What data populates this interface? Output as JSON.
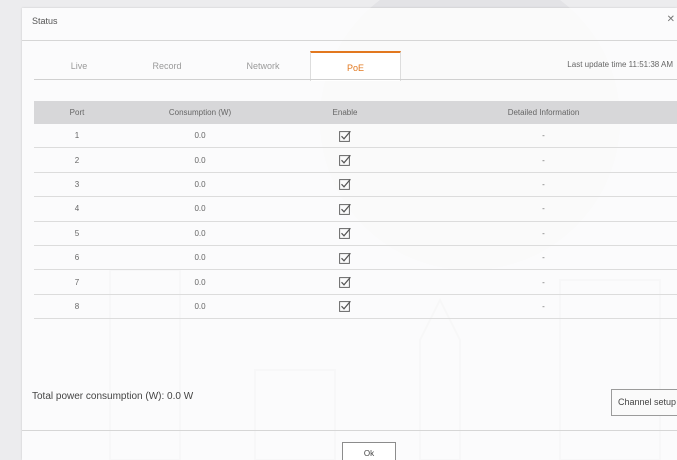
{
  "dialog": {
    "title": "Status",
    "close_icon": "close-icon"
  },
  "tabs": [
    {
      "label": "Live",
      "active": false
    },
    {
      "label": "Record",
      "active": false
    },
    {
      "label": "Network",
      "active": false
    },
    {
      "label": "PoE",
      "active": true
    }
  ],
  "last_update": "Last update time 11:51:38 AM",
  "table": {
    "headers": [
      "Port",
      "Consumption (W)",
      "Enable",
      "Detailed Information"
    ],
    "rows": [
      {
        "port": "1",
        "consumption": "0.0",
        "enabled": true,
        "info": "-"
      },
      {
        "port": "2",
        "consumption": "0.0",
        "enabled": true,
        "info": "-"
      },
      {
        "port": "3",
        "consumption": "0.0",
        "enabled": true,
        "info": "-"
      },
      {
        "port": "4",
        "consumption": "0.0",
        "enabled": true,
        "info": "-"
      },
      {
        "port": "5",
        "consumption": "0.0",
        "enabled": true,
        "info": "-"
      },
      {
        "port": "6",
        "consumption": "0.0",
        "enabled": true,
        "info": "-"
      },
      {
        "port": "7",
        "consumption": "0.0",
        "enabled": true,
        "info": "-"
      },
      {
        "port": "8",
        "consumption": "0.0",
        "enabled": true,
        "info": "-"
      }
    ]
  },
  "total_power": "Total power consumption (W): 0.0 W",
  "buttons": {
    "channel_setup": "Channel setup",
    "ok": "Ok"
  },
  "colors": {
    "accent": "#e2781f",
    "header_bg": "#d0d0d2"
  }
}
